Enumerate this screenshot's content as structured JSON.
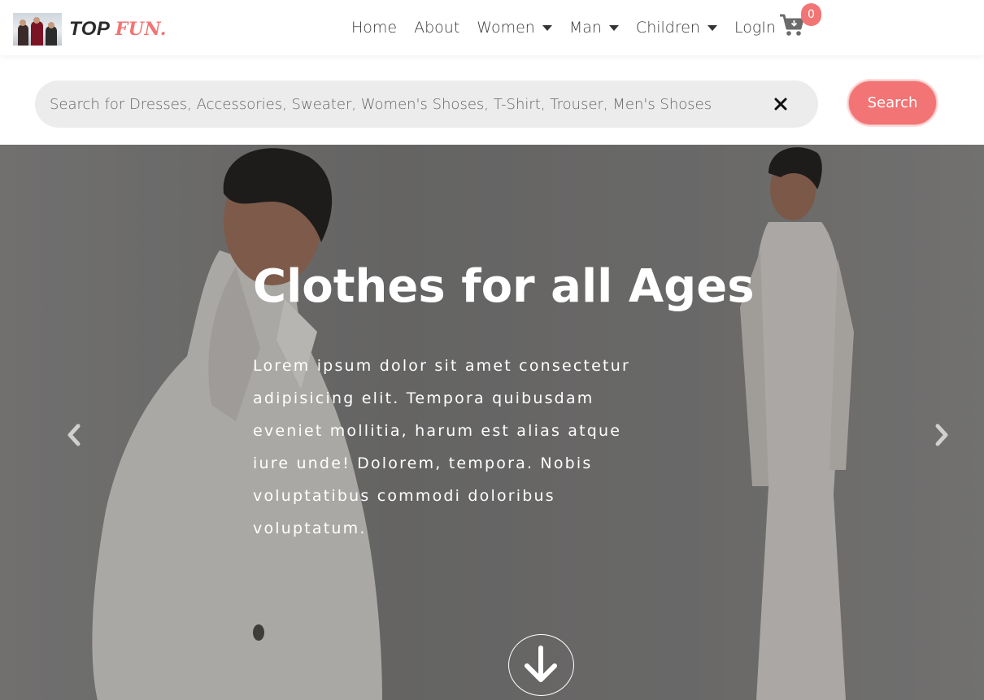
{
  "brand": {
    "name": "TOP",
    "accent": "FUN."
  },
  "nav": {
    "items": [
      {
        "label": "Home",
        "dropdown": false
      },
      {
        "label": "About",
        "dropdown": false
      },
      {
        "label": "Women",
        "dropdown": true
      },
      {
        "label": "Man",
        "dropdown": true
      },
      {
        "label": "Children",
        "dropdown": true
      },
      {
        "label": "LogIn",
        "dropdown": false
      }
    ],
    "cart_icon": "shopping-cart-icon",
    "cart_count": "0"
  },
  "search": {
    "placeholder": "Search for Dresses, Accessories, Sweater, Women's Shoses, T-Shirt, Trouser, Men's Shoses",
    "value": "",
    "clear_icon": "close-icon",
    "button_label": "Search"
  },
  "hero": {
    "title": "Clothes for all Ages",
    "text": "Lorem ipsum dolor sit amet consectetur adipisicing elit. Tempora quibusdam eveniet mollitia, harum est alias atque iure unde! Dolorem, tempora. Nobis voluptatibus commodi doloribus voluptatum.",
    "prev_icon": "chevron-left-icon",
    "next_icon": "chevron-right-icon",
    "scroll_icon": "arrow-down-icon"
  },
  "colors": {
    "accent": "#f27474",
    "nav_text": "#3a3a3a",
    "search_bg": "#ececec"
  }
}
